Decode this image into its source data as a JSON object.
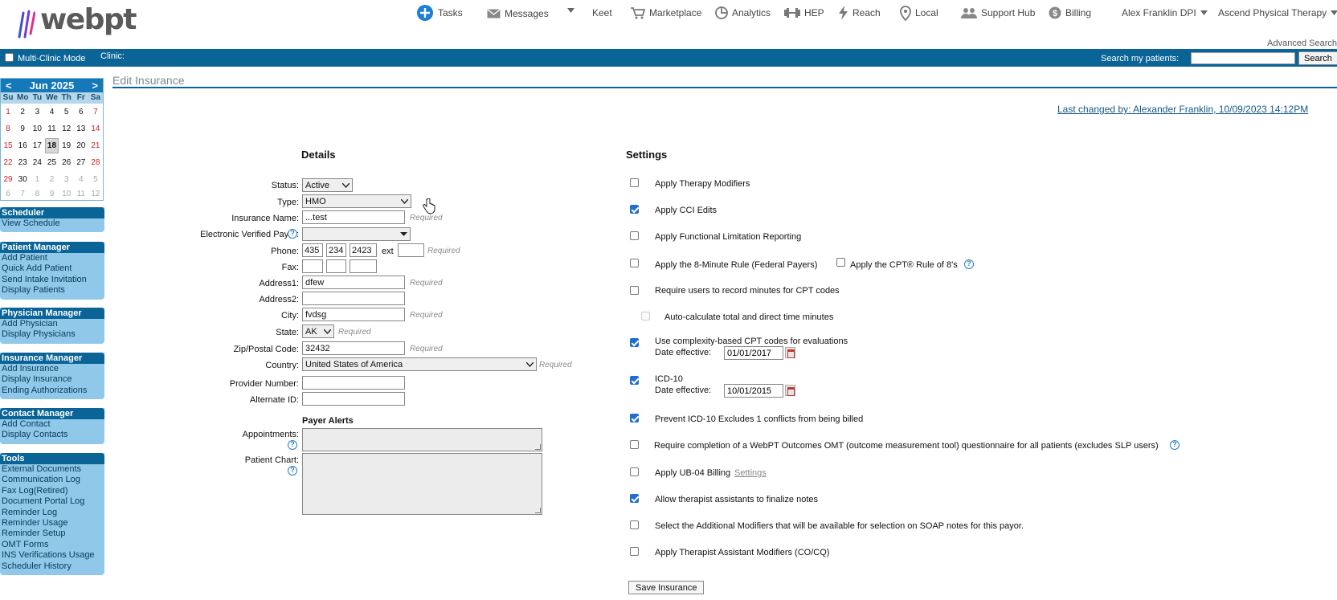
{
  "app": {
    "logo": "webpt",
    "advanced_search": "Advanced Search"
  },
  "nav": [
    {
      "id": "tasks",
      "label": "Tasks",
      "icon": "plus-circle-icon"
    },
    {
      "id": "messages",
      "label": "Messages",
      "icon": "envelope-icon"
    },
    {
      "id": "keet",
      "label": "Keet",
      "icon": "none"
    },
    {
      "id": "marketplace",
      "label": "Marketplace",
      "icon": "cart-icon"
    },
    {
      "id": "analytics",
      "label": "Analytics",
      "icon": "pie-chart-icon"
    },
    {
      "id": "hep",
      "label": "HEP",
      "icon": "dumbbell-icon"
    },
    {
      "id": "reach",
      "label": "Reach",
      "icon": "bolt-icon"
    },
    {
      "id": "local",
      "label": "Local",
      "icon": "map-pin-icon"
    },
    {
      "id": "support",
      "label": "Support Hub",
      "icon": "people-icon"
    },
    {
      "id": "billing",
      "label": "Billing",
      "icon": "dollar-icon"
    }
  ],
  "user": {
    "name": "Alex Franklin DPI",
    "org": "Ascend Physical Therapy"
  },
  "bar": {
    "multi_clinic": "Multi-Clinic Mode",
    "clinic_label": "Clinic:",
    "search_label": "Search my patients:",
    "search_value": "",
    "search_button": "Search"
  },
  "calendar": {
    "month": "Jun 2025",
    "prev": "<",
    "next": ">",
    "dows": [
      "Su",
      "Mo",
      "Tu",
      "We",
      "Th",
      "Fr",
      "Sa"
    ],
    "weeks": [
      [
        "1",
        "2",
        "3",
        "4",
        "5",
        "6",
        "7"
      ],
      [
        "8",
        "9",
        "10",
        "11",
        "12",
        "13",
        "14"
      ],
      [
        "15",
        "16",
        "17",
        "18",
        "19",
        "20",
        "21"
      ],
      [
        "22",
        "23",
        "24",
        "25",
        "26",
        "27",
        "28"
      ],
      [
        "29",
        "30",
        "1",
        "2",
        "3",
        "4",
        "5"
      ],
      [
        "6",
        "7",
        "8",
        "9",
        "10",
        "11",
        "12"
      ]
    ],
    "today": "18"
  },
  "sidebar": [
    {
      "title": "Scheduler",
      "links": [
        "View Schedule"
      ]
    },
    {
      "title": "Patient Manager",
      "links": [
        "Add Patient",
        "Quick Add Patient",
        "Send Intake Invitation",
        "Display Patients"
      ]
    },
    {
      "title": "Physician Manager",
      "links": [
        "Add Physician",
        "Display Physicians"
      ]
    },
    {
      "title": "Insurance Manager",
      "links": [
        "Add Insurance",
        "Display Insurance",
        "Ending Authorizations"
      ]
    },
    {
      "title": "Contact Manager",
      "links": [
        "Add Contact",
        "Display Contacts"
      ]
    },
    {
      "title": "Tools",
      "links": [
        "External Documents",
        "Communication Log",
        "Fax Log(Retired)",
        "Document Portal Log",
        "Reminder Log",
        "Reminder Usage",
        "Reminder Setup",
        "OMT Forms",
        "INS Verifications Usage",
        "Scheduler History"
      ]
    }
  ],
  "page": {
    "title": "Edit Insurance",
    "last_changed": "Last changed by: Alexander Franklin, 10/09/2023 14:12PM"
  },
  "details": {
    "title": "Details",
    "required": "Required",
    "status": {
      "label": "Status:",
      "value": "Active"
    },
    "type": {
      "label": "Type:",
      "value": "HMO"
    },
    "insurance_name": {
      "label": "Insurance Name:",
      "value": "...test"
    },
    "evp": {
      "label": "Electronic Verified Payer:",
      "value": ""
    },
    "phone": {
      "label": "Phone:",
      "area": "435",
      "prefix": "234",
      "line": "2423",
      "ext_label": "ext",
      "ext": ""
    },
    "fax": {
      "label": "Fax:",
      "area": "",
      "prefix": "",
      "line": ""
    },
    "address1": {
      "label": "Address1:",
      "value": "dfew"
    },
    "address2": {
      "label": "Address2:",
      "value": ""
    },
    "city": {
      "label": "City:",
      "value": "fvdsg"
    },
    "state": {
      "label": "State:",
      "value": "AK"
    },
    "zip": {
      "label": "Zip/Postal Code:",
      "value": "32432"
    },
    "country": {
      "label": "Country:",
      "value": "United States of America"
    },
    "provider_number": {
      "label": "Provider Number:",
      "value": ""
    },
    "alternate_id": {
      "label": "Alternate ID:",
      "value": ""
    },
    "payer_alerts": "Payer Alerts",
    "appointments": {
      "label": "Appointments:",
      "value": ""
    },
    "patient_chart": {
      "label": "Patient Chart:",
      "value": ""
    }
  },
  "settings": {
    "title": "Settings",
    "date_effective": "Date effective:",
    "items": {
      "therapy_modifiers": {
        "label": "Apply Therapy Modifiers",
        "checked": false
      },
      "cci_edits": {
        "label": "Apply CCI Edits",
        "checked": true
      },
      "functional_limitation": {
        "label": "Apply Functional Limitation Reporting",
        "checked": false
      },
      "eight_minute": {
        "label": "Apply the 8-Minute Rule (Federal Payers)",
        "checked": false
      },
      "cpt_rule": {
        "label": "Apply the CPT® Rule of 8's",
        "checked": false
      },
      "record_minutes": {
        "label": "Require users to record minutes for CPT codes",
        "checked": false
      },
      "auto_calc": {
        "label": "Auto-calculate total and direct time minutes",
        "checked": false
      },
      "complexity_cpt": {
        "label": "Use complexity-based CPT codes for evaluations",
        "checked": true,
        "date": "01/01/2017"
      },
      "icd10": {
        "label": "ICD-10",
        "checked": true,
        "date": "10/01/2015"
      },
      "prevent_icd": {
        "label": "Prevent ICD-10 Excludes 1 conflicts from being billed",
        "checked": true
      },
      "omt": {
        "label": "Require completion of a WebPT Outcomes OMT (outcome measurement tool) questionnaire for all patients (excludes SLP users)",
        "checked": false
      },
      "ub04": {
        "label": "Apply UB-04 Billing",
        "link": "Settings",
        "checked": false
      },
      "assistants_finalize": {
        "label": "Allow therapist assistants to finalize notes",
        "checked": true
      },
      "additional_modifiers": {
        "label": "Select the Additional Modifiers that will be available for selection on SOAP notes for this payor.",
        "checked": false
      },
      "co_cq": {
        "label": "Apply Therapist Assistant Modifiers (CO/CQ)",
        "checked": false
      }
    },
    "save": "Save Insurance"
  }
}
